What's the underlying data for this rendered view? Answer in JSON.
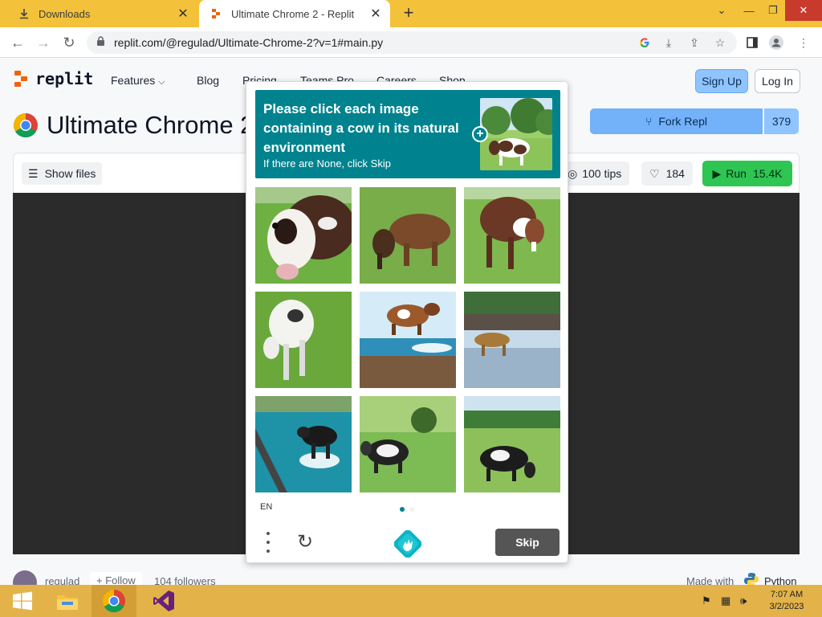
{
  "browser": {
    "tabs": [
      {
        "title": "Downloads",
        "icon": "download-icon",
        "active": false
      },
      {
        "title": "Ultimate Chrome 2 - Replit",
        "icon": "replit-favicon",
        "active": true
      }
    ],
    "new_tab_glyph": "+",
    "url": "replit.com/@regulad/Ultimate-Chrome-2?v=1#main.py",
    "window_controls": {
      "minimize": "—",
      "maximize": "❐",
      "close": "✕"
    }
  },
  "replit": {
    "logo_text": "replit",
    "nav": [
      "Features",
      "Blog",
      "Pricing",
      "Teams Pro",
      "Careers",
      "Shop"
    ],
    "signup_label": "Sign Up",
    "login_label": "Log In",
    "repl_title": "Ultimate Chrome 2",
    "fork_label": "Fork Repl",
    "fork_count": "379",
    "show_files_label": "Show files",
    "tips_label": "100 tips",
    "likes_count": "184",
    "run_label": "Run",
    "run_count": "15.4K",
    "author": "regulad",
    "follow_label": "Follow",
    "followers": "104 followers",
    "made_with_label": "Made with",
    "language": "Python"
  },
  "captcha": {
    "prompt_main": "Please click each image containing a cow in its natural environment",
    "prompt_sub": "If there are None, click Skip",
    "language": "EN",
    "skip_label": "Skip",
    "accent_color": "#00838f",
    "images": [
      "cow-closeup-grass",
      "brown-cow-grazing",
      "brown-cow-standing",
      "white-cow-grazing",
      "brown-cow-flying-over-sea",
      "cow-over-water",
      "black-cow-in-sea-waves",
      "black-cow-in-field",
      "black-cow-grazing-meadow"
    ],
    "page_dots": 2,
    "active_dot": 0
  },
  "taskbar": {
    "apps": [
      "start-button",
      "file-explorer",
      "chrome",
      "visual-studio"
    ],
    "clock_time": "7:07 AM",
    "clock_date": "3/2/2023"
  }
}
